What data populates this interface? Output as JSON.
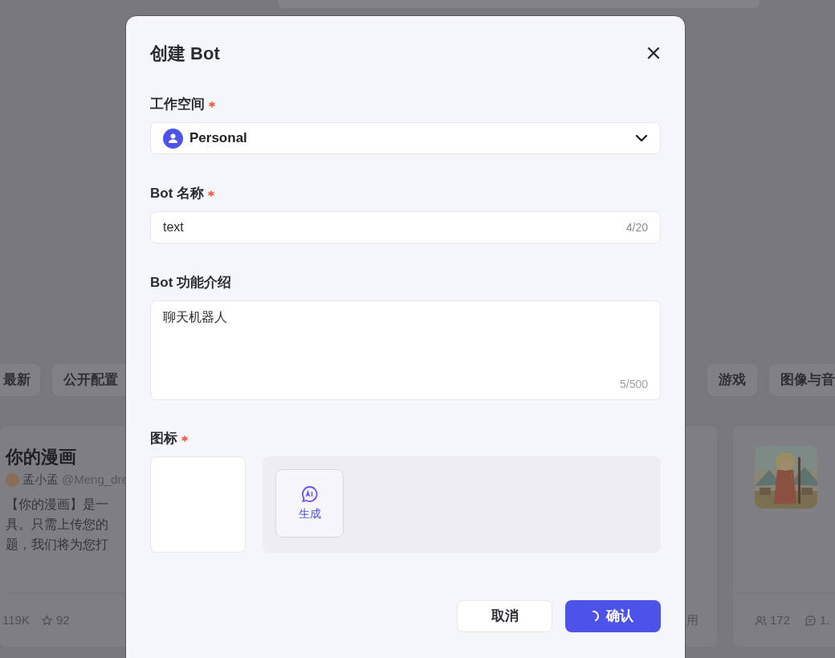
{
  "background": {
    "categories": [
      {
        "label": "最新"
      },
      {
        "label": "公开配置"
      },
      {
        "label": "游戏"
      },
      {
        "label": "图像与音"
      }
    ],
    "cards": [
      {
        "kind": "bot",
        "title": "你的漫画",
        "author": "孟小孟",
        "handle": "@Meng_dre",
        "description": [
          "【你的漫画】是一",
          "具。只需上传您的",
          "题，我们将为您打"
        ],
        "stats": [
          "119K",
          "92"
        ]
      },
      {
        "kind": "fragment",
        "stats": [
          "用"
        ]
      },
      {
        "kind": "picture",
        "stats": [
          "172",
          "1."
        ]
      }
    ]
  },
  "dialog": {
    "title": "创建 Bot",
    "fields": [
      {
        "kind": "select",
        "label": "工作空间",
        "required": true,
        "value": "Personal"
      },
      {
        "kind": "input",
        "label": "Bot 名称",
        "required": true,
        "value": "text",
        "counter": "4/20"
      },
      {
        "kind": "textarea",
        "label": "Bot 功能介绍",
        "required": false,
        "value": "聊天机器人",
        "counter": "5/500"
      },
      {
        "kind": "icon",
        "label": "图标",
        "required": true,
        "generate_label": "生成"
      }
    ],
    "buttons": [
      {
        "kind": "secondary",
        "label": "取消",
        "loading": false
      },
      {
        "kind": "primary",
        "label": "确认",
        "loading": true
      }
    ]
  }
}
